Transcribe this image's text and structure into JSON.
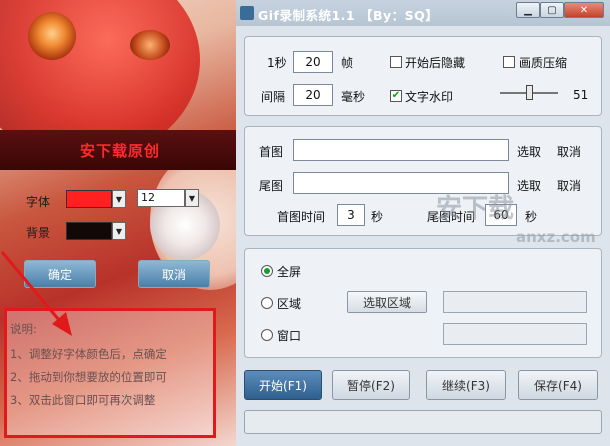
{
  "left_dialog": {
    "title": "安下载原创",
    "font_label": "字体",
    "bg_label": "背景",
    "font_color": "#ff2020",
    "bg_color": "#120808",
    "font_size": "12",
    "ok_label": "确定",
    "cancel_label": "取消",
    "help": {
      "heading": "说明:",
      "line1": "1、调整好字体颜色后，点确定",
      "line2": "2、拖动到你想要放的位置即可",
      "line3": "3、双击此窗口即可再次调整"
    }
  },
  "window": {
    "title": "Gif录制系统1.1 【By：SQ】",
    "min_icon": "minimize-icon",
    "max_icon": "maximize-icon",
    "close_icon": "close-icon"
  },
  "settings": {
    "per_second_label": "1秒",
    "fps": "20",
    "frames_unit": "帧",
    "hide_after_start_label": "开始后隐藏",
    "hide_after_start": false,
    "quality_compress_label": "画质压缩",
    "quality_compress": false,
    "interval_label": "间隔",
    "interval": "20",
    "ms_unit": "毫秒",
    "text_watermark_label": "文字水印",
    "text_watermark": true,
    "slider_value": "51"
  },
  "images": {
    "first_label": "首图",
    "last_label": "尾图",
    "select_label": "选取",
    "cancel_label": "取消",
    "first_time_label": "首图时间",
    "first_time": "3",
    "last_time_label": "尾图时间",
    "last_time": "60",
    "seconds_unit": "秒"
  },
  "capture": {
    "fullscreen_label": "全屏",
    "region_label": "区域",
    "window_label": "窗口",
    "select_region_label": "选取区域",
    "selected": "fullscreen"
  },
  "actions": {
    "start": "开始(F1)",
    "pause": "暂停(F2)",
    "resume": "继续(F3)",
    "save": "保存(F4)"
  },
  "watermark": {
    "text": "安下载",
    "sub": "anxz.com"
  }
}
